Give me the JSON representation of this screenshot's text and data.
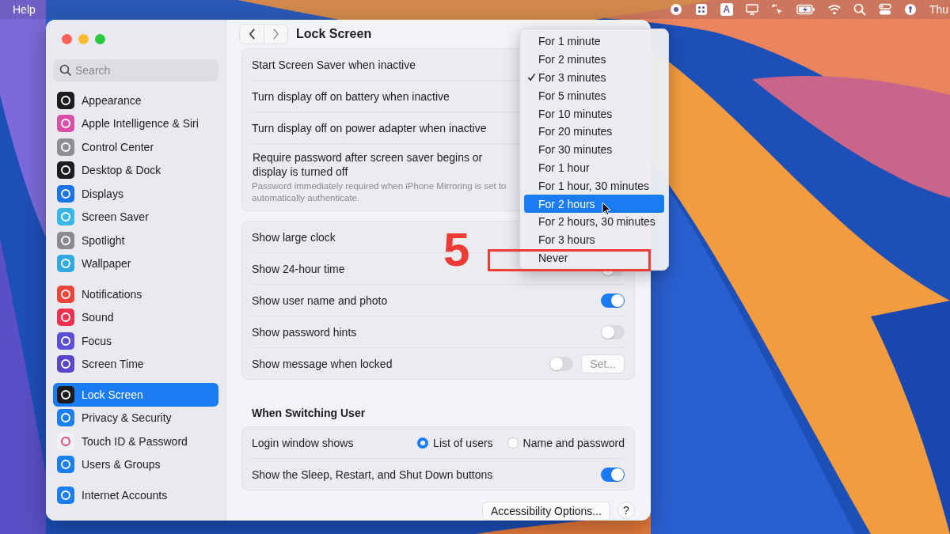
{
  "menu_bar": {
    "app_menu": "Help",
    "input_source": "A",
    "clock": "Thu"
  },
  "sidebar": {
    "search": {
      "placeholder": "Search"
    },
    "groups": [
      {
        "items": [
          {
            "label": "Appearance",
            "selected": false,
            "color": "#1c1c1e"
          },
          {
            "label": "Apple Intelligence & Siri",
            "selected": false,
            "color": "#d94fa8"
          },
          {
            "label": "Control Center",
            "selected": false,
            "color": "#8e8e93"
          },
          {
            "label": "Desktop & Dock",
            "selected": false,
            "color": "#1c1c1e"
          },
          {
            "label": "Displays",
            "selected": false,
            "color": "#1a73e8"
          },
          {
            "label": "Screen Saver",
            "selected": false,
            "color": "#38b6e8"
          },
          {
            "label": "Spotlight",
            "selected": false,
            "color": "#8a8a8f"
          },
          {
            "label": "Wallpaper",
            "selected": false,
            "color": "#2fa9e0"
          }
        ]
      },
      {
        "items": [
          {
            "label": "Notifications",
            "selected": false,
            "color": "#f0453a"
          },
          {
            "label": "Sound",
            "selected": false,
            "color": "#f0304f"
          },
          {
            "label": "Focus",
            "selected": false,
            "color": "#5b4fd6"
          },
          {
            "label": "Screen Time",
            "selected": false,
            "color": "#5b46c9"
          }
        ]
      },
      {
        "items": [
          {
            "label": "Lock Screen",
            "selected": true,
            "color": "#1c1c1e"
          },
          {
            "label": "Privacy & Security",
            "selected": false,
            "color": "#1a7ff0"
          },
          {
            "label": "Touch ID & Password",
            "selected": false,
            "color": "#f2f2f4"
          },
          {
            "label": "Users & Groups",
            "selected": false,
            "color": "#1a7ff0"
          }
        ]
      },
      {
        "items": [
          {
            "label": "Internet Accounts",
            "selected": false,
            "color": "#1a7ff0"
          }
        ]
      }
    ]
  },
  "content": {
    "title": "Lock Screen",
    "sections": [
      {
        "rows": [
          {
            "kind": "plain",
            "label": "Start Screen Saver when inactive"
          },
          {
            "kind": "plain",
            "label": "Turn display off on battery when inactive"
          },
          {
            "kind": "plain",
            "label": "Turn display off on power adapter when inactive"
          },
          {
            "kind": "plain",
            "label": "Require password after screen saver begins or display is turned off",
            "note": "Password immediately required when iPhone Mirroring is set to automatically authenticate."
          }
        ]
      },
      {
        "rows": [
          {
            "kind": "plain",
            "label": "Show large clock"
          },
          {
            "kind": "toggle",
            "label": "Show 24-hour time",
            "on": false
          },
          {
            "kind": "toggle",
            "label": "Show user name and photo",
            "on": true
          },
          {
            "kind": "toggle",
            "label": "Show password hints",
            "on": false
          },
          {
            "kind": "toggle",
            "label": "Show message when locked",
            "on": false,
            "button": "Set..."
          }
        ]
      },
      {
        "heading": "When Switching User",
        "rows": [
          {
            "kind": "radio",
            "label": "Login window shows",
            "options": [
              {
                "label": "List of users",
                "selected": true
              },
              {
                "label": "Name and password",
                "selected": false
              }
            ]
          },
          {
            "kind": "toggle",
            "label": "Show the Sleep, Restart, and Shut Down buttons",
            "on": true
          }
        ]
      }
    ]
  },
  "footer": {
    "buttons": [
      "Accessibility Options...",
      "?"
    ]
  },
  "popup_menu": {
    "items": [
      {
        "label": "For 1 minute",
        "checked": false,
        "selected": false
      },
      {
        "label": "For 2 minutes",
        "checked": false,
        "selected": false
      },
      {
        "label": "For 3 minutes",
        "checked": true,
        "selected": false
      },
      {
        "label": "For 5 minutes",
        "checked": false,
        "selected": false
      },
      {
        "label": "For 10 minutes",
        "checked": false,
        "selected": false
      },
      {
        "label": "For 20 minutes",
        "checked": false,
        "selected": false
      },
      {
        "label": "For 30 minutes",
        "checked": false,
        "selected": false
      },
      {
        "label": "For 1 hour",
        "checked": false,
        "selected": false
      },
      {
        "label": "For 1 hour, 30 minutes",
        "checked": false,
        "selected": false
      },
      {
        "label": "For 2 hours",
        "checked": false,
        "selected": true
      },
      {
        "label": "For 2 hours, 30 minutes",
        "checked": false,
        "selected": false
      },
      {
        "label": "For 3 hours",
        "checked": false,
        "selected": false
      },
      {
        "label": "Never",
        "checked": false,
        "selected": false
      }
    ]
  },
  "annotation": {
    "step": "5"
  }
}
